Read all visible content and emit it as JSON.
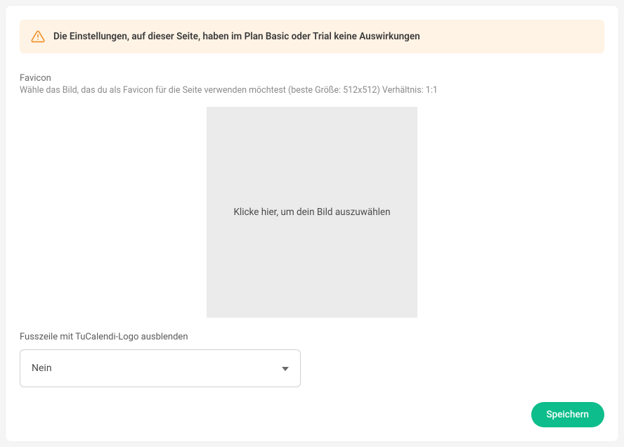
{
  "alert": {
    "text": "Die Einstellungen, auf dieser Seite, haben im Plan Basic oder Trial keine Auswirkungen"
  },
  "favicon": {
    "label": "Favicon",
    "description": "Wähle das Bild, das du als Favicon für die Seite verwenden möchtest (beste Größe: 512x512) Verhältnis: 1:1",
    "upload_text": "Klicke hier, um dein Bild auszuwählen"
  },
  "footer_logo": {
    "label": "Fusszeile mit TuCalendi-Logo ausblenden",
    "selected": "Nein"
  },
  "actions": {
    "save_label": "Speichern"
  }
}
